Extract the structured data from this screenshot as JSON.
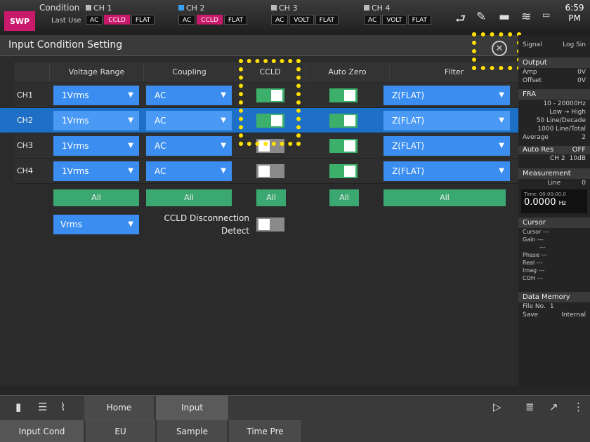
{
  "topbar": {
    "mode": "SWP",
    "condition": "Condition",
    "last_use": "Last Use",
    "channels": [
      {
        "name": "CH 1",
        "tags": [
          "AC",
          "CCLD",
          "FLAT"
        ]
      },
      {
        "name": "CH 2",
        "tags": [
          "AC",
          "CCLD",
          "FLAT"
        ]
      },
      {
        "name": "CH 3",
        "tags": [
          "AC",
          "VOLT",
          "FLAT"
        ]
      },
      {
        "name": "CH 4",
        "tags": [
          "AC",
          "VOLT",
          "FLAT"
        ]
      }
    ],
    "battery": "1\n2",
    "time": "6:59",
    "ampm": "PM"
  },
  "page": {
    "title": "Input Condition Setting"
  },
  "table": {
    "headers": [
      "Voltage Range",
      "Coupling",
      "CCLD",
      "Auto Zero",
      "Filter"
    ],
    "rows": [
      {
        "label": "CH1",
        "range": "1Vrms",
        "coupling": "AC",
        "ccld": true,
        "autozero": true,
        "filter": "Z(FLAT)"
      },
      {
        "label": "CH2",
        "range": "1Vrms",
        "coupling": "AC",
        "ccld": true,
        "autozero": true,
        "filter": "Z(FLAT)"
      },
      {
        "label": "CH3",
        "range": "1Vrms",
        "coupling": "AC",
        "ccld": false,
        "autozero": true,
        "filter": "Z(FLAT)"
      },
      {
        "label": "CH4",
        "range": "1Vrms",
        "coupling": "AC",
        "ccld": false,
        "autozero": true,
        "filter": "Z(FLAT)"
      }
    ],
    "all_label": "All",
    "unit": "Vrms",
    "ccld_detect_line1": "CCLD Disconnection",
    "ccld_detect_line2": "Detect",
    "ccld_detect_on": false
  },
  "right_panel": {
    "signal": "Signal",
    "signal_val": "Log Sin",
    "output": "Output",
    "amp": "Amp",
    "amp_val": "0V",
    "offset": "Offset",
    "offset_val": "0V",
    "fra": "FRA",
    "fra_range": "10 - 20000Hz",
    "fra_dir": "Low → High",
    "fra_lines": "50 Line/Decade",
    "fra_total": "1000 Line/Total",
    "average": "Average",
    "average_val": "2",
    "auto_res": "Auto Res",
    "auto_res_val": "OFF",
    "auto_res_ch": "CH 2",
    "auto_res_db": "10dB",
    "measurement": "Measurement",
    "meas_line": "Line",
    "meas_line_val": "0",
    "meas_time": "Time: 00:00:00.0",
    "meas_value": "0.0000",
    "meas_unit": "Hz",
    "cursor": "Cursor",
    "cursor_rows": [
      {
        "k": "Cursor",
        "v": "---"
      },
      {
        "k": "Gain",
        "v": "---"
      },
      {
        "k": "",
        "v": "---"
      },
      {
        "k": "Phase",
        "v": "---"
      },
      {
        "k": "Real",
        "v": "---"
      },
      {
        "k": "Imag",
        "v": "---"
      },
      {
        "k": "COH",
        "v": "---"
      }
    ],
    "data_memory": "Data Memory",
    "file_no": "File No.",
    "file_no_val": "1",
    "save": "Save",
    "save_val": "Internal"
  },
  "bottom": {
    "tabs1": [
      "Home",
      "Input"
    ],
    "tabs2": [
      "Input Cond",
      "EU",
      "Sample",
      "Time Pre"
    ]
  },
  "colors": {
    "accent_blue": "#3b8ef0",
    "selected_row": "#1e6fc6",
    "toggle_on": "#3cb06a",
    "mode_pink": "#c9196b",
    "highlight": "#ffe000"
  }
}
